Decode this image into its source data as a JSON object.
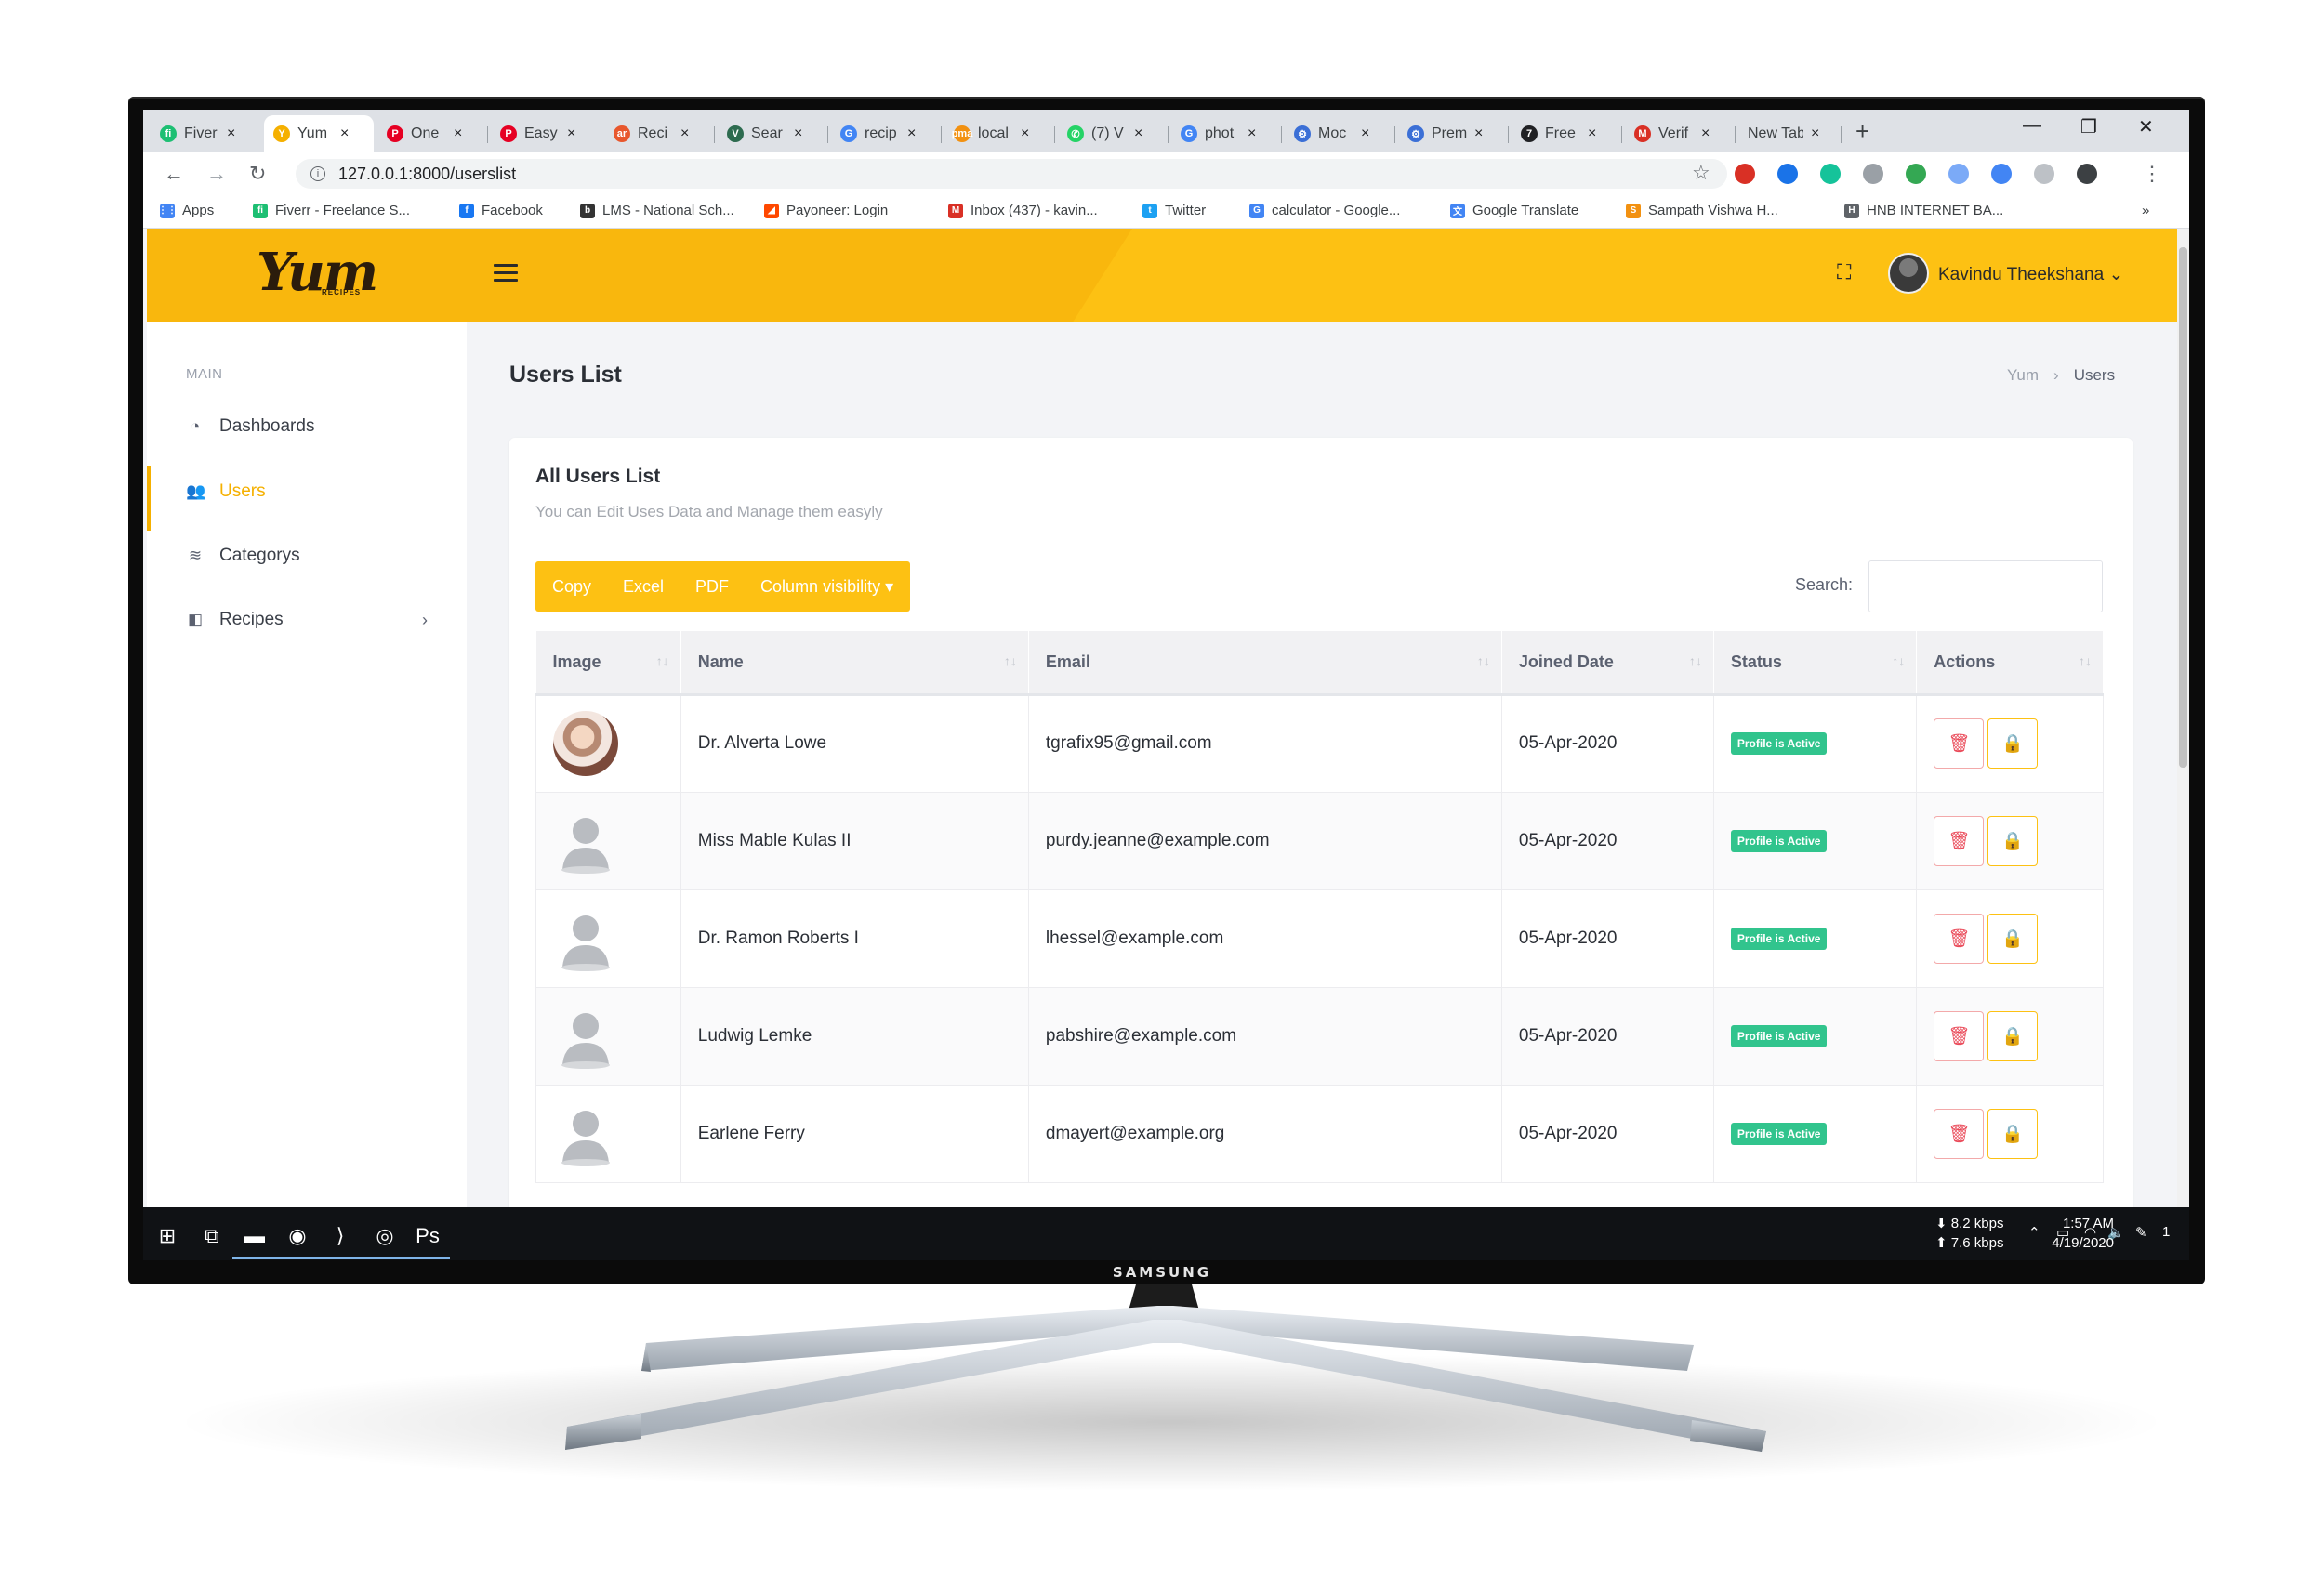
{
  "browser": {
    "tabs": [
      {
        "label": "Fiver",
        "icon": "fiverr-icon",
        "color": "#1dbf73",
        "glyph": "fi"
      },
      {
        "label": "Yum",
        "icon": "yum-favicon-icon",
        "color": "#f5b000",
        "glyph": "Y",
        "active": true
      },
      {
        "label": "One",
        "icon": "pinterest-icon",
        "color": "#e60023",
        "glyph": "P"
      },
      {
        "label": "Easy",
        "icon": "pinterest-icon",
        "color": "#e60023",
        "glyph": "P"
      },
      {
        "label": "Reci",
        "icon": "allrecipes-icon",
        "color": "#e8572d",
        "glyph": "ar"
      },
      {
        "label": "Sear",
        "icon": "search-favicon-icon",
        "color": "#2d6b4f",
        "glyph": "V"
      },
      {
        "label": "recip",
        "icon": "google-icon",
        "color": "#4285f4",
        "glyph": "G"
      },
      {
        "label": "local",
        "icon": "phpmyadmin-icon",
        "color": "#f29111",
        "glyph": "pma"
      },
      {
        "label": "(7) V",
        "icon": "whatsapp-icon",
        "color": "#25d366",
        "glyph": "✆"
      },
      {
        "label": "phot",
        "icon": "google-icon",
        "color": "#4285f4",
        "glyph": "G"
      },
      {
        "label": "Moc",
        "icon": "mockup-icon",
        "color": "#3b6fd6",
        "glyph": "⚙"
      },
      {
        "label": "Prem",
        "icon": "mockup-icon",
        "color": "#3b6fd6",
        "glyph": "⚙"
      },
      {
        "label": "Free",
        "icon": "free-favicon-icon",
        "color": "#202124",
        "glyph": "7"
      },
      {
        "label": "Verif",
        "icon": "gmail-icon",
        "color": "#d93025",
        "glyph": "M"
      },
      {
        "label": "New Tab",
        "icon": "",
        "color": "",
        "glyph": ""
      }
    ],
    "tab_close": "×",
    "new_tab": "+",
    "window_controls": {
      "minimize": "—",
      "restore": "❐",
      "close": "✕"
    },
    "nav": {
      "back": "←",
      "forward": "→",
      "reload": "↻"
    },
    "url": "127.0.0.1:8000/userslist",
    "star": "☆",
    "extensions": [
      {
        "icon": "adblock-icon",
        "color": "#d93025"
      },
      {
        "icon": "extension-icon",
        "color": "#1a73e8"
      },
      {
        "icon": "grammarly-icon",
        "color": "#15c39a"
      },
      {
        "icon": "extension-icon",
        "color": "#9aa0a6"
      },
      {
        "icon": "extension-icon",
        "color": "#34a853"
      },
      {
        "icon": "extension-icon",
        "color": "#7baaf7"
      },
      {
        "icon": "extension-icon",
        "color": "#4285f4"
      },
      {
        "icon": "extension-icon",
        "color": "#bdc1c6"
      },
      {
        "icon": "profile-icon",
        "color": "#3c4043"
      }
    ],
    "menu": "⋮",
    "bookmarks": [
      {
        "label": "Apps",
        "icon": "apps-icon",
        "color": "#4285f4",
        "glyph": "⋮⋮"
      },
      {
        "label": "Fiverr - Freelance S...",
        "icon": "fiverr-icon",
        "color": "#1dbf73",
        "glyph": "fi"
      },
      {
        "label": "Facebook",
        "icon": "facebook-icon",
        "color": "#1877f2",
        "glyph": "f"
      },
      {
        "label": "LMS - National Sch...",
        "icon": "lms-icon",
        "color": "#333333",
        "glyph": "b"
      },
      {
        "label": "Payoneer: Login",
        "icon": "payoneer-icon",
        "color": "#ff4800",
        "glyph": "◢"
      },
      {
        "label": "Inbox (437) - kavin...",
        "icon": "gmail-icon",
        "color": "#d93025",
        "glyph": "M"
      },
      {
        "label": "Twitter",
        "icon": "twitter-icon",
        "color": "#1da1f2",
        "glyph": "t"
      },
      {
        "label": "calculator - Google...",
        "icon": "google-icon",
        "color": "#4285f4",
        "glyph": "G"
      },
      {
        "label": "Google Translate",
        "icon": "translate-icon",
        "color": "#4285f4",
        "glyph": "文"
      },
      {
        "label": "Sampath Vishwa H...",
        "icon": "bank-icon",
        "color": "#f29111",
        "glyph": "S"
      },
      {
        "label": "HNB INTERNET BA...",
        "icon": "bank-icon",
        "color": "#5f6368",
        "glyph": "H"
      }
    ],
    "bookmarks_more": "»"
  },
  "app": {
    "colors": {
      "accent": "#fdc113",
      "badge": "#31c48d",
      "danger": "#ea4b5a"
    },
    "logo": "Yum",
    "logo_sub": "RECIPES",
    "user_name": "Kavindu Theekshana",
    "sidebar": {
      "heading": "MAIN",
      "items": [
        {
          "label": "Dashboards",
          "icon": "gauge-icon",
          "glyph": "◔"
        },
        {
          "label": "Users",
          "icon": "users-icon",
          "glyph": "👥",
          "active": true
        },
        {
          "label": "Categorys",
          "icon": "layers-icon",
          "glyph": "≋"
        },
        {
          "label": "Recipes",
          "icon": "recipes-icon",
          "glyph": "◧",
          "chevron": "›"
        }
      ]
    },
    "page_title": "Users List",
    "breadcrumb": [
      "Yum",
      "›",
      "Users"
    ],
    "card": {
      "title": "All Users List",
      "subtitle": "You can Edit Uses Data and Manage them easyly",
      "buttons": [
        "Copy",
        "Excel",
        "PDF",
        "Column visibility ▾"
      ],
      "search_label": "Search:",
      "search_value": ""
    },
    "table": {
      "headers": [
        "Image",
        "Name",
        "Email",
        "Joined Date",
        "Status",
        "Actions"
      ],
      "sort_glyph": "↑↓",
      "rows": [
        {
          "image": "photo",
          "name": "Dr. Alverta Lowe",
          "email": "tgrafix95@gmail.com",
          "joined": "05-Apr-2020",
          "status": "Profile is Active"
        },
        {
          "image": "default",
          "name": "Miss Mable Kulas II",
          "email": "purdy.jeanne@example.com",
          "joined": "05-Apr-2020",
          "status": "Profile is Active"
        },
        {
          "image": "default",
          "name": "Dr. Ramon Roberts I",
          "email": "lhessel@example.com",
          "joined": "05-Apr-2020",
          "status": "Profile is Active"
        },
        {
          "image": "default",
          "name": "Ludwig Lemke",
          "email": "pabshire@example.com",
          "joined": "05-Apr-2020",
          "status": "Profile is Active"
        },
        {
          "image": "default",
          "name": "Earlene Ferry",
          "email": "dmayert@example.org",
          "joined": "05-Apr-2020",
          "status": "Profile is Active"
        }
      ],
      "delete_glyph": "🗑",
      "lock_glyph": "🔒"
    }
  },
  "taskbar": {
    "apps": [
      {
        "icon": "windows-start-icon",
        "glyph": "⊞"
      },
      {
        "icon": "task-view-icon",
        "glyph": "⧉"
      },
      {
        "icon": "file-explorer-icon",
        "glyph": "▬",
        "open": true
      },
      {
        "icon": "spotify-icon",
        "glyph": "◉",
        "open": true
      },
      {
        "icon": "vscode-icon",
        "glyph": "⟩",
        "open": true
      },
      {
        "icon": "chrome-icon",
        "glyph": "◎",
        "open": true
      },
      {
        "icon": "photoshop-icon",
        "glyph": "Ps",
        "open": true
      }
    ],
    "net_down": "8.2 kbps",
    "net_up": "7.6 kbps",
    "time": "1:57 AM",
    "date": "4/19/2020",
    "notification_count": "1"
  },
  "monitor": {
    "brand": "SAMSUNG"
  }
}
